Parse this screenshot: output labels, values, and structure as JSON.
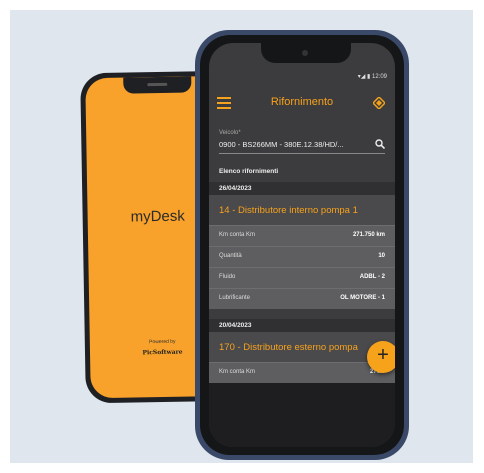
{
  "back_phone": {
    "brand": "myDesk",
    "powered_by": "Powered by",
    "logo": "PicSoftware"
  },
  "front_phone": {
    "status": "▾◢ ▮ 12:09",
    "title": "Rifornimento",
    "vehicle_label": "Veicolo*",
    "vehicle_value": "0900 - BS266MM - 380E.12.38/HD/...",
    "list_title": "Elenco rifornimenti",
    "groups": [
      {
        "date": "26/04/2023",
        "title": "14 - Distributore interno pompa 1",
        "rows": [
          {
            "label": "Km conta Km",
            "value": "271.750 km"
          },
          {
            "label": "Quantità",
            "value": "10"
          },
          {
            "label": "Fluido",
            "value": "ADBL - 2"
          },
          {
            "label": "Lubrificante",
            "value": "OL MOTORE - 1"
          }
        ]
      },
      {
        "date": "20/04/2023",
        "title": "170 - Distributore esterno pompa",
        "rows": [
          {
            "label": "Km conta Km",
            "value": "271.7"
          }
        ]
      }
    ],
    "fab_label": "+"
  },
  "colors": {
    "accent": "#f7a21b",
    "back_screen": "#f9a22b",
    "frame": "#3a4968"
  },
  "icons": [
    "menu-icon",
    "diamond-icon",
    "search-icon",
    "plus-icon"
  ]
}
